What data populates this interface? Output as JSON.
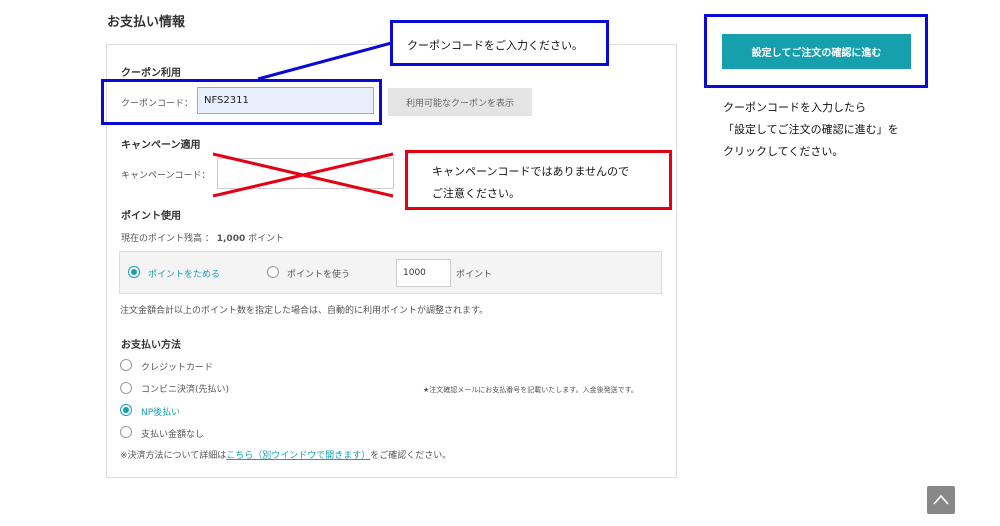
{
  "payment": {
    "section_title": "お支払い情報",
    "coupon": {
      "heading": "クーポン利用",
      "label": "クーポンコード：",
      "value": "NFS2311",
      "show_button": "利用可能なクーポンを表示"
    },
    "campaign": {
      "heading": "キャンペーン適用",
      "label": "キャンペーンコード：",
      "value": ""
    },
    "points": {
      "heading": "ポイント使用",
      "balance_prefix": "現在のポイント残高 ：",
      "balance_value": "1,000",
      "balance_unit": "ポイント",
      "opt_save": "ポイントをためる",
      "opt_use": "ポイントを使う",
      "use_amount": "1000",
      "use_unit": "ポイント",
      "note": "注文金額合計以上のポイント数を指定した場合は、自動的に利用ポイントが調整されます。"
    },
    "method": {
      "heading": "お支払い方法",
      "options": [
        "クレジットカード",
        "コンビニ決済(先払い)",
        "NP後払い",
        "支払い金額なし"
      ],
      "selected": "NP後払い",
      "konbini_note": "★注文確認メールにお支払番号を記載いたします。入金後発送です。",
      "footer_prefix": "※決済方法について詳細は",
      "footer_link": "こちら（別ウインドウで開きます）",
      "footer_suffix": "をご確認ください。"
    }
  },
  "confirm_button": "設定してご注文の確認に進む",
  "annotations": {
    "coupon_callout": "クーポンコードをご入力ください。",
    "campaign_callout_line1": "キャンペーンコードではありませんので",
    "campaign_callout_line2": "ご注意ください。",
    "side_note_line1": "クーポンコードを入力したら",
    "side_note_line2": "「設定してご注文の確認に進む」を",
    "side_note_line3": "クリックしてください。"
  },
  "colors": {
    "accent": "#16a0ae",
    "annotation_blue": "#0a0ad6",
    "annotation_red": "#e60012"
  },
  "icons": {
    "page_top": "chevron-up-icon"
  }
}
